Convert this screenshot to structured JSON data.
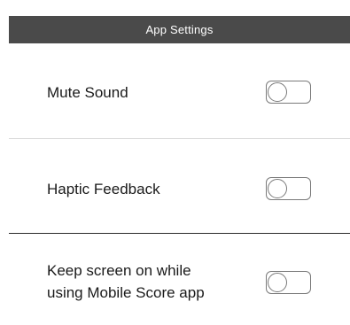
{
  "header": {
    "title": "App Settings"
  },
  "settings": {
    "items": [
      {
        "label": "Mute Sound",
        "enabled": false
      },
      {
        "label": "Haptic Feedback",
        "enabled": false
      },
      {
        "label": "Keep screen on while\nusing Mobile Score app",
        "enabled": false
      }
    ]
  },
  "colors": {
    "header_background": "#4a4a4a",
    "header_text": "#ffffff",
    "toggle_border": "#7a7a7a",
    "divider_light": "#d9d9d9",
    "divider_dark": "#2a2a2a"
  }
}
